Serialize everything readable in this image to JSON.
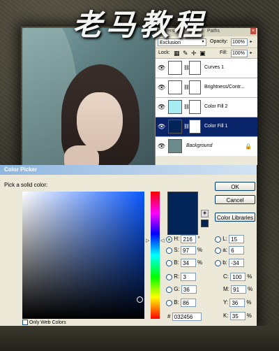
{
  "watermark": "老马教程",
  "layers_panel": {
    "tabs": [
      "Layers",
      "Paths"
    ],
    "blend_mode": "Exclusion",
    "opacity_label": "Opacity:",
    "opacity_value": "100%",
    "lock_label": "Lock:",
    "fill_label": "Fill:",
    "fill_value": "100%",
    "layers": [
      {
        "name": "Curves 1",
        "thumb_color": "#ffffff",
        "selected": false
      },
      {
        "name": "Brightness/Contr...",
        "thumb_color": "#ffffff",
        "selected": false
      },
      {
        "name": "Color Fill 2",
        "thumb_color": "#a6ecf2",
        "selected": false
      },
      {
        "name": "Color Fill 1",
        "thumb_color": "#032456",
        "selected": true
      },
      {
        "name": "Background",
        "thumb_color": "#6b8a8a",
        "selected": false
      }
    ]
  },
  "color_picker": {
    "title": "Color Picker",
    "prompt": "Pick a solid color:",
    "current_color": "#032456",
    "buttons": {
      "ok": "OK",
      "cancel": "Cancel",
      "libraries": "Color Libraries"
    },
    "hsb": {
      "h": "216",
      "s": "97",
      "b": "34"
    },
    "rgb": {
      "r": "3",
      "g": "36",
      "b": "86"
    },
    "lab": {
      "l": "15",
      "a": "6",
      "b": "-34"
    },
    "cmyk": {
      "c": "100",
      "m": "91",
      "y": "36",
      "k": "35"
    },
    "hex": "032456",
    "labels": {
      "h": "H:",
      "s": "S:",
      "b": "B:",
      "r": "R:",
      "g": "G:",
      "bb": "B:",
      "l": "L:",
      "a": "a:",
      "lb": "b:",
      "c": "C:",
      "m": "M:",
      "y": "Y:",
      "k": "K:",
      "hash": "#"
    },
    "units": {
      "deg": "°",
      "pct": "%"
    },
    "web_colors_label": "Only Web Colors"
  }
}
